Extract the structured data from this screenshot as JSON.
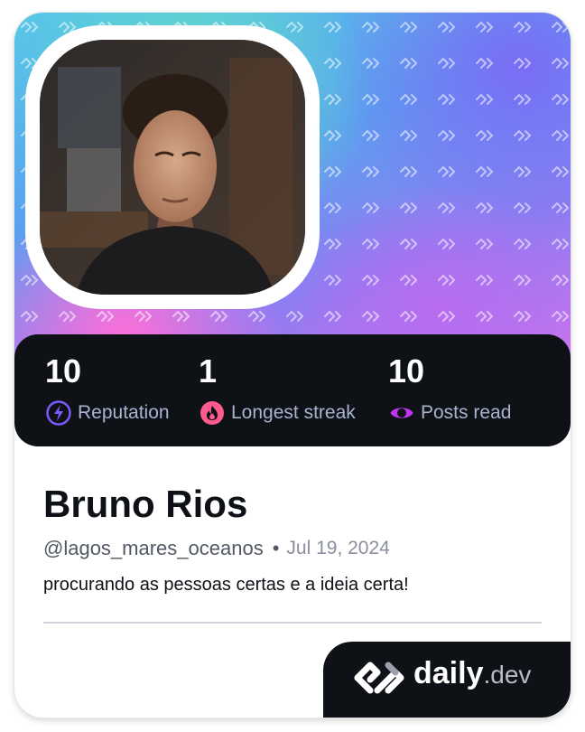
{
  "profile": {
    "name": "Bruno Rios",
    "username": "@lagos_mares_oceanos",
    "separator": "•",
    "joined": "Jul 19, 2024",
    "bio": "procurando as pessoas certas e a ideia certa!"
  },
  "stats": [
    {
      "value": "10",
      "label": "Reputation",
      "icon": "lightning-icon",
      "color": "#7a5af8"
    },
    {
      "value": "1",
      "label": "Longest streak",
      "icon": "flame-icon",
      "color": "#ff5a8e"
    },
    {
      "value": "10",
      "label": "Posts read",
      "icon": "eye-ring-icon",
      "color": "#c036f0"
    }
  ],
  "brand": {
    "name": "daily",
    "suffix": ".dev",
    "icon": "daily-dev-logo-icon"
  },
  "colors": {
    "dark_panel": "#0e1217",
    "label_gray": "#a8b3cf"
  }
}
